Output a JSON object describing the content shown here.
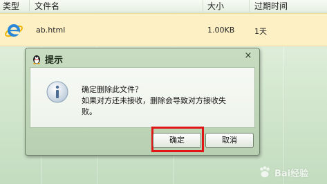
{
  "file_list": {
    "columns": [
      "类型",
      "文件名",
      "大小",
      "过期时间"
    ],
    "rows": [
      {
        "icon": "ie-icon",
        "name": "ab.html",
        "size": "1.00KB",
        "expiry": "1天"
      }
    ]
  },
  "dialog": {
    "title": "提示",
    "message_lines": [
      "确定删除此文件？",
      "如果对方还未接收，删除会导致对方接收失",
      "败。"
    ],
    "ok_label": "确定",
    "cancel_label": "取消",
    "close_glyph": "×"
  },
  "watermark": {
    "text": "Bai经验"
  },
  "colors": {
    "highlight": "#e01515",
    "selected_row": "#fdf0c4"
  }
}
